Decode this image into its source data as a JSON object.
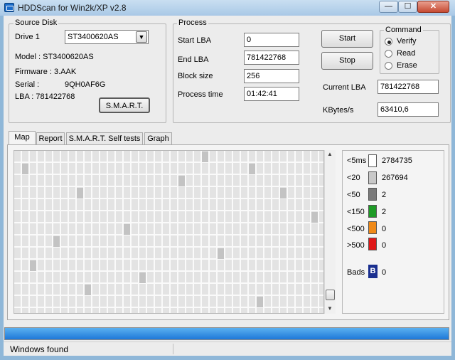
{
  "window": {
    "title": "HDDScan for Win2k/XP  v2.8",
    "min_glyph": "—",
    "max_glyph": "☐",
    "close_glyph": "✕"
  },
  "source_disk": {
    "group_label": "Source Disk",
    "drive_label": "Drive  1",
    "drive_value": "ST3400620AS",
    "model": "Model : ST3400620AS",
    "firmware": "Firmware : 3.AAK",
    "serial_label": "Serial :",
    "serial_value": "9QH0AF6G",
    "lba": "LBA :  781422768",
    "smart_button": "S.M.A.R.T."
  },
  "process": {
    "group_label": "Process",
    "start_lba_label": "Start LBA",
    "start_lba_value": "0",
    "end_lba_label": "End LBA",
    "end_lba_value": "781422768",
    "block_size_label": "Block size",
    "block_size_value": "256",
    "process_time_label": "Process time",
    "process_time_value": "01:42:41",
    "start_button": "Start",
    "stop_button": "Stop",
    "current_lba_label": "Current LBA",
    "current_lba_value": "781422768",
    "kbytes_label": "KBytes/s",
    "kbytes_value": "63410,6"
  },
  "command": {
    "group_label": "Command",
    "options": [
      "Verify",
      "Read",
      "Erase"
    ],
    "selected": "Verify"
  },
  "tabs": [
    "Map",
    "Report",
    "S.M.A.R.T. Self tests",
    "Graph"
  ],
  "active_tab": "Map",
  "legend": [
    {
      "label": "<5ms",
      "count": "2784735",
      "color": "#ffffff"
    },
    {
      "label": "<20",
      "count": "267694",
      "color": "#c8c8c8"
    },
    {
      "label": "<50",
      "count": "2",
      "color": "#7a7a7a"
    },
    {
      "label": "<150",
      "count": "2",
      "color": "#1e9b26"
    },
    {
      "label": "<500",
      "count": "0",
      "color": "#f08a18"
    },
    {
      "label": ">500",
      "count": "0",
      "color": "#e01818"
    }
  ],
  "bads": {
    "label": "Bads",
    "glyph": "B",
    "count": "0",
    "color": "#1a2f8f"
  },
  "progress": 1.0,
  "status": "Windows found"
}
